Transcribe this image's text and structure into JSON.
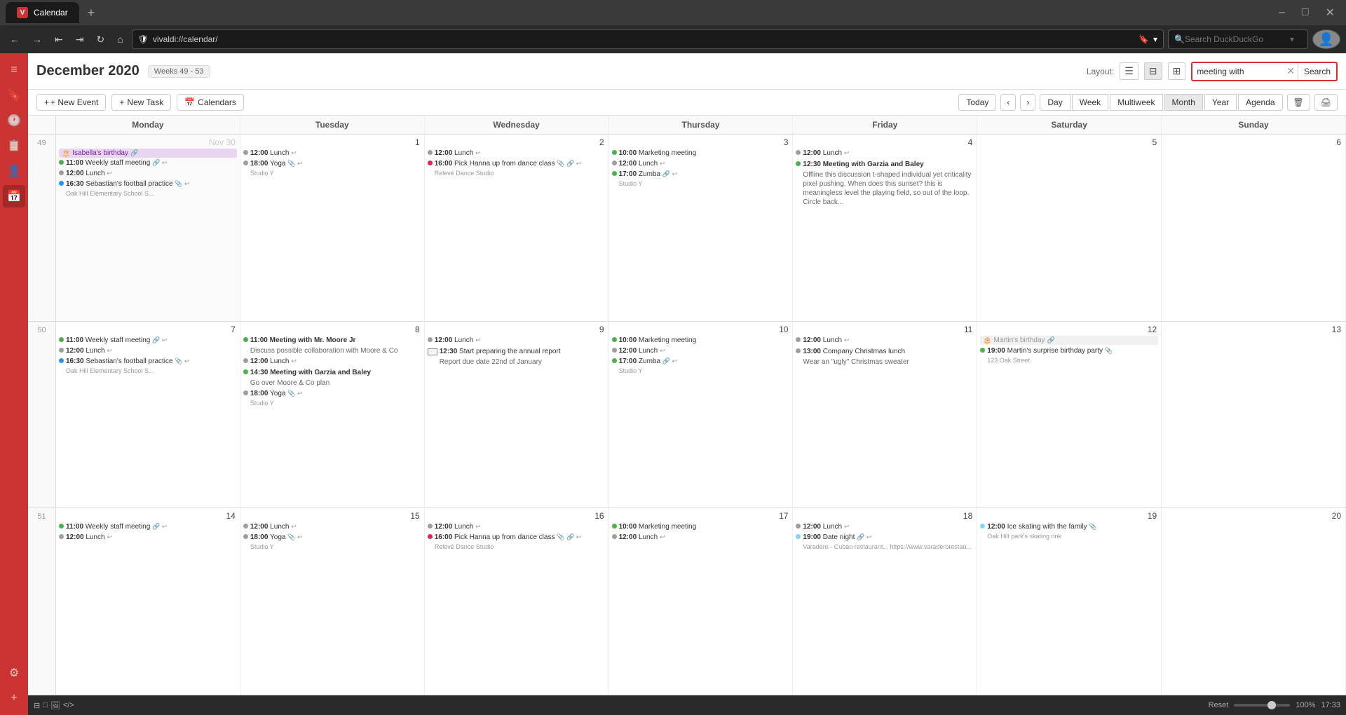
{
  "browser": {
    "tab_title": "Calendar",
    "address": "vivaldi://calendar/",
    "search_placeholder": "Search DuckDuckGo",
    "new_tab_icon": "+",
    "close_icon": "✕",
    "minimize_icon": "–",
    "maximize_icon": "□"
  },
  "calendar": {
    "title": "December 2020",
    "weeks_range": "Weeks 49 - 53",
    "layout_label": "Layout:",
    "search_value": "meeting with",
    "search_button": "Search",
    "new_event_label": "+ New Event",
    "new_task_label": "+ New Task",
    "calendars_label": "Calendars",
    "today_label": "Today",
    "view_tabs": [
      "Day",
      "Week",
      "Multiweek",
      "Month",
      "Year",
      "Agenda"
    ],
    "active_view": "Month",
    "day_headers": [
      "Monday",
      "Tuesday",
      "Wednesday",
      "Thursday",
      "Friday",
      "Saturday",
      "Sunday"
    ]
  },
  "weeks": [
    {
      "num": "49",
      "days": [
        {
          "num": "Nov 30",
          "other_month": true,
          "events": [
            {
              "type": "birthday",
              "text": "Isabella's birthday"
            },
            {
              "type": "dot",
              "color": "green",
              "time": "11:00",
              "text": "Weekly staff meeting",
              "icons": [
                "🔗",
                "↩"
              ]
            },
            {
              "type": "dot",
              "color": "gray",
              "time": "12:00",
              "text": "Lunch",
              "icons": [
                "↩"
              ]
            },
            {
              "type": "dot",
              "color": "blue",
              "time": "16:30",
              "text": "Sebastian's football practice",
              "icons": [
                "📎",
                "↩"
              ],
              "sub": "Oak Hill Elementary School S..."
            }
          ]
        },
        {
          "num": "1",
          "events": [
            {
              "type": "dot",
              "color": "gray",
              "time": "12:00",
              "text": "Lunch",
              "icons": [
                "↩"
              ]
            },
            {
              "type": "dot",
              "color": "gray",
              "time": "18:00",
              "text": "Yoga Studio Y",
              "icons": [
                "📎",
                "↩"
              ]
            }
          ]
        },
        {
          "num": "2",
          "events": [
            {
              "type": "dot",
              "color": "gray",
              "time": "12:00",
              "text": "Lunch",
              "icons": [
                "↩"
              ]
            },
            {
              "type": "dot",
              "color": "pink",
              "time": "16:00",
              "text": "Pick Hanna up from dance class",
              "icons": [
                "📎",
                "🔗",
                "↩"
              ],
              "sub": "Relevé Dance Studio"
            }
          ]
        },
        {
          "num": "3",
          "events": [
            {
              "type": "dot",
              "color": "green",
              "time": "10:00",
              "text": "Marketing meeting"
            },
            {
              "type": "dot",
              "color": "gray",
              "time": "12:00",
              "text": "Lunch",
              "icons": [
                "↩"
              ]
            },
            {
              "type": "dot",
              "color": "green",
              "time": "17:00",
              "text": "Zumba",
              "icons": [
                "🔗",
                "↩"
              ],
              "sub": "Studio Y"
            }
          ]
        },
        {
          "num": "4",
          "events": [
            {
              "type": "dot",
              "color": "gray",
              "time": "12:00",
              "text": "Lunch",
              "icons": [
                "↩"
              ]
            },
            {
              "type": "meeting-big",
              "color": "green",
              "time": "12:30",
              "text": "Meeting with Garzia and Baley",
              "bold": true,
              "desc": "Offline this discussion t-shaped individual yet criticality pixel pushing. When does this sunset? this is meaningless level the playing field, so out of the loop. Circle back..."
            }
          ]
        },
        {
          "num": "5",
          "events": []
        },
        {
          "num": "6",
          "other_month": false,
          "events": []
        }
      ]
    },
    {
      "num": "50",
      "days": [
        {
          "num": "7",
          "events": [
            {
              "type": "dot",
              "color": "green",
              "time": "11:00",
              "text": "Weekly staff meeting",
              "icons": [
                "🔗",
                "↩"
              ]
            },
            {
              "type": "dot",
              "color": "gray",
              "time": "12:00",
              "text": "Lunch",
              "icons": [
                "↩"
              ]
            },
            {
              "type": "dot",
              "color": "blue",
              "time": "16:30",
              "text": "Sebastian's football practice",
              "icons": [
                "📎",
                "↩"
              ],
              "sub": "Oak Hill Elementary School S..."
            }
          ]
        },
        {
          "num": "8",
          "events": [
            {
              "type": "meeting-big",
              "color": "green",
              "time": "11:00",
              "text": "Meeting with Mr. Moore Jr",
              "bold": true,
              "desc": "Discuss possible collaboration with Moore & Co"
            },
            {
              "type": "dot",
              "color": "gray",
              "time": "12:00",
              "text": "Lunch",
              "icons": [
                "↩"
              ]
            },
            {
              "type": "meeting-big",
              "color": "green",
              "time": "14:30",
              "text": "Meeting with Garzia and Baley",
              "bold": true,
              "desc": "Go over Moore & Co plan"
            },
            {
              "type": "dot",
              "color": "gray",
              "time": "18:00",
              "text": "Yoga",
              "icons": [
                "📎",
                "↩"
              ],
              "sub": "Studio Y"
            }
          ]
        },
        {
          "num": "9",
          "events": [
            {
              "type": "dot",
              "color": "gray",
              "time": "12:00",
              "text": "Lunch",
              "icons": [
                "↩"
              ]
            },
            {
              "type": "task",
              "time": "12:30",
              "text": "Start preparing the annual report",
              "desc": "Report due date 22nd of January"
            }
          ]
        },
        {
          "num": "10",
          "events": [
            {
              "type": "dot",
              "color": "green",
              "time": "10:00",
              "text": "Marketing meeting"
            },
            {
              "type": "dot",
              "color": "gray",
              "time": "12:00",
              "text": "Lunch",
              "icons": [
                "↩"
              ]
            },
            {
              "type": "dot",
              "color": "green",
              "time": "17:00",
              "text": "Zumba",
              "icons": [
                "🔗",
                "↩"
              ],
              "sub": "Studio Y"
            }
          ]
        },
        {
          "num": "11",
          "events": [
            {
              "type": "dot",
              "color": "gray",
              "time": "12:00",
              "text": "Lunch",
              "icons": [
                "↩"
              ]
            },
            {
              "type": "dot",
              "color": "gray",
              "time": "13:00",
              "text": "Company Christmas lunch",
              "desc": "Wear an \"ugly\" Christmas sweater"
            }
          ]
        },
        {
          "num": "12",
          "events": [
            {
              "type": "birthday",
              "text": "Martin's birthday"
            },
            {
              "type": "dot",
              "color": "green",
              "time": "19:00",
              "text": "Martin's surprise birthday party",
              "icons": [
                "📎"
              ],
              "sub": "123 Oak Street"
            }
          ]
        },
        {
          "num": "13",
          "events": []
        }
      ]
    },
    {
      "num": "51",
      "days": [
        {
          "num": "14",
          "events": [
            {
              "type": "dot",
              "color": "green",
              "time": "11:00",
              "text": "Weekly staff meeting",
              "icons": [
                "🔗",
                "↩"
              ]
            },
            {
              "type": "dot",
              "color": "gray",
              "time": "12:00",
              "text": "Lunch",
              "icons": [
                "↩"
              ]
            }
          ]
        },
        {
          "num": "15",
          "events": [
            {
              "type": "dot",
              "color": "gray",
              "time": "12:00",
              "text": "Lunch",
              "icons": [
                "↩"
              ]
            },
            {
              "type": "dot",
              "color": "gray",
              "time": "18:00",
              "text": "Yoga Studio Y",
              "icons": [
                "📎",
                "↩"
              ]
            }
          ]
        },
        {
          "num": "16",
          "events": [
            {
              "type": "dot",
              "color": "gray",
              "time": "12:00",
              "text": "Lunch",
              "icons": [
                "↩"
              ]
            },
            {
              "type": "dot",
              "color": "pink",
              "time": "16:00",
              "text": "Pick Hanna up from dance class",
              "icons": [
                "📎",
                "🔗",
                "↩"
              ],
              "sub": "Relevé Dance Studio"
            }
          ]
        },
        {
          "num": "17",
          "events": [
            {
              "type": "dot",
              "color": "green",
              "time": "10:00",
              "text": "Marketing meeting"
            },
            {
              "type": "dot",
              "color": "gray",
              "time": "12:00",
              "text": "Lunch",
              "icons": [
                "↩"
              ]
            }
          ]
        },
        {
          "num": "18",
          "events": [
            {
              "type": "dot",
              "color": "gray",
              "time": "12:00",
              "text": "Lunch",
              "icons": [
                "↩"
              ]
            },
            {
              "type": "dot",
              "color": "light-blue",
              "time": "19:00",
              "text": "Date night",
              "icons": [
                "🔗",
                "↩"
              ],
              "sub": "Varadero - Cuban restaurant... https://www.varaderorestau..."
            }
          ]
        },
        {
          "num": "19",
          "events": [
            {
              "type": "dot",
              "color": "light-blue",
              "time": "12:00",
              "text": "Ice skating with the family",
              "icons": [
                "📎"
              ],
              "sub": "Oak Hill park's skating rink"
            }
          ]
        },
        {
          "num": "20",
          "events": []
        }
      ]
    }
  ],
  "statusbar": {
    "reset_label": "Reset",
    "zoom": "100%",
    "time": "17:33"
  }
}
